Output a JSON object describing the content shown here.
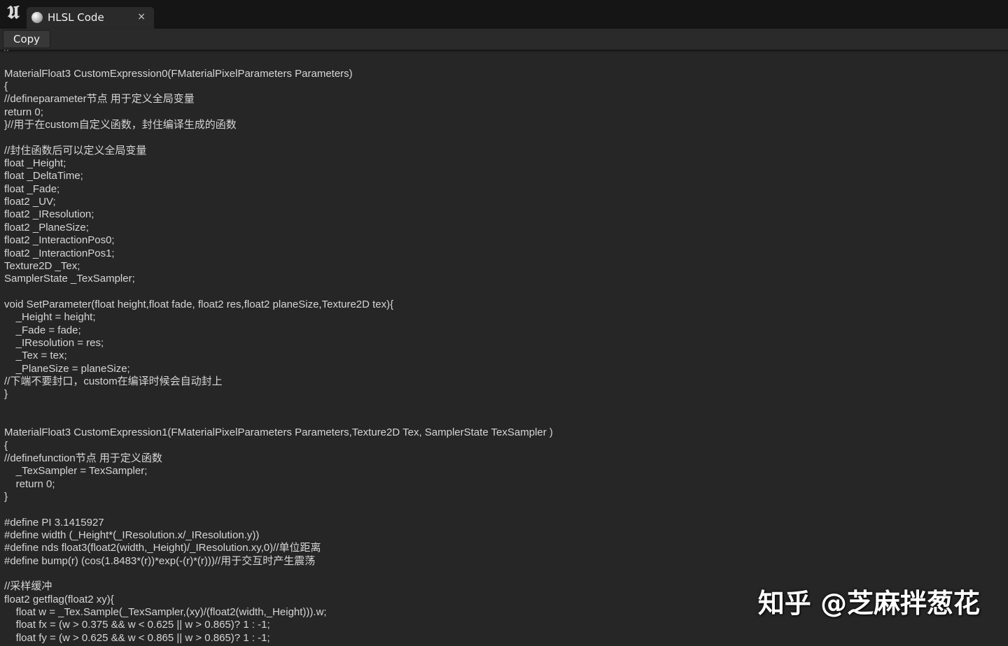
{
  "window": {
    "logo_icon": "unreal-engine-logo-icon",
    "tab": {
      "icon": "material-sphere-icon",
      "title": "HLSL Code",
      "close_glyph": "×"
    }
  },
  "toolbar": {
    "copy_label": "Copy"
  },
  "code": {
    "text": "//\n\nMaterialFloat3 CustomExpression0(FMaterialPixelParameters Parameters)\n{\n//defineparameter节点 用于定义全局变量\nreturn 0;\n}//用于在custom自定义函数，封住编译生成的函数\n\n//封住函数后可以定义全局变量\nfloat _Height;\nfloat _DeltaTime;\nfloat _Fade;\nfloat2 _UV;\nfloat2 _IResolution;\nfloat2 _PlaneSize;\nfloat2 _InteractionPos0;\nfloat2 _InteractionPos1;\nTexture2D _Tex;\nSamplerState _TexSampler;\n\nvoid SetParameter(float height,float fade, float2 res,float2 planeSize,Texture2D tex){\n    _Height = height;\n    _Fade = fade;\n    _IResolution = res;\n    _Tex = tex;\n    _PlaneSize = planeSize;\n//下端不要封口，custom在编译时候会自动封上\n}\n\n\nMaterialFloat3 CustomExpression1(FMaterialPixelParameters Parameters,Texture2D Tex, SamplerState TexSampler )\n{\n//definefunction节点 用于定义函数\n    _TexSampler = TexSampler;\n    return 0;\n}\n\n#define PI 3.1415927\n#define width (_Height*(_IResolution.x/_IResolution.y))\n#define nds float3(float2(width,_Height)/_IResolution.xy,0)//单位距离\n#define bump(r) (cos(1.8483*(r))*exp(-(r)*(r)))//用于交互时产生震荡\n\n//采样缓冲\nfloat2 getflag(float2 xy){\n    float w = _Tex.Sample(_TexSampler,(xy)/(float2(width,_Height))).w;\n    float fx = (w > 0.375 && w < 0.625 || w > 0.865)? 1 : -1;\n    float fy = (w > 0.625 && w < 0.865 || w > 0.865)? 1 : -1;"
  },
  "watermark": {
    "text": "知乎 @芝麻拌葱花"
  }
}
